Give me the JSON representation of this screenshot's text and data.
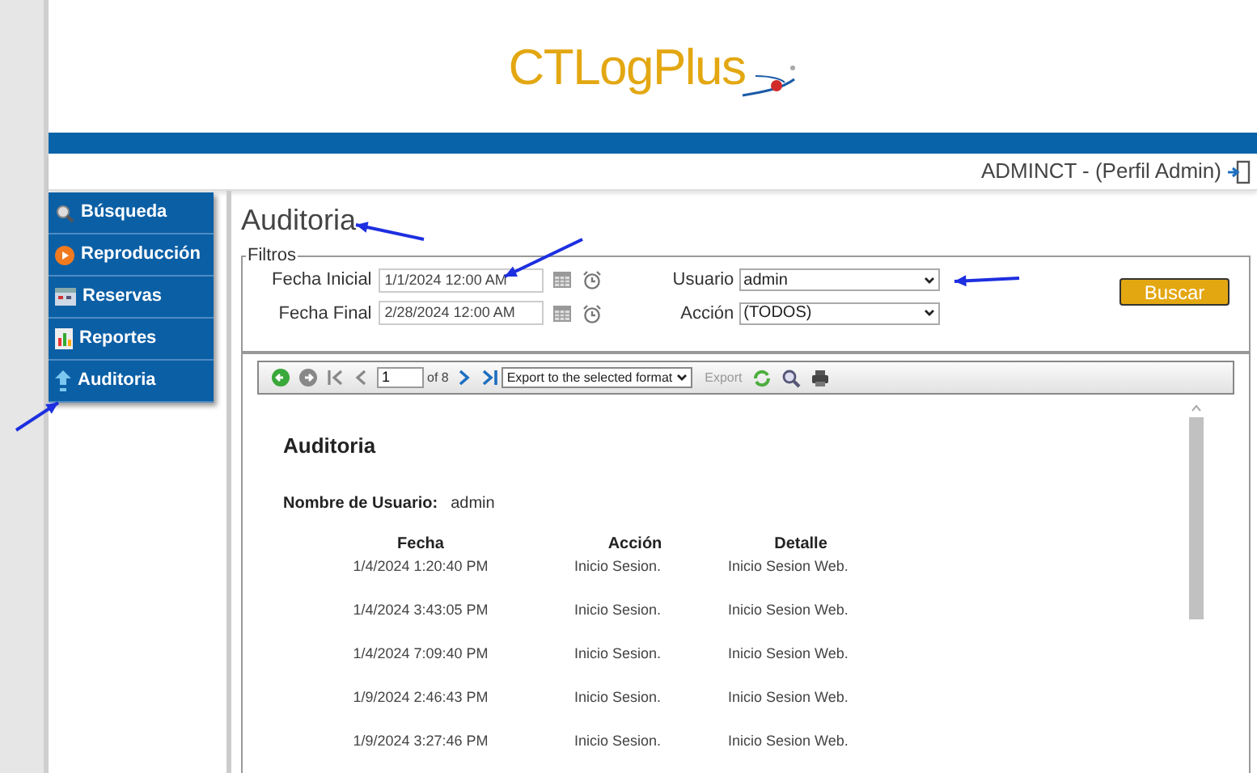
{
  "logo": {
    "text": "CTLogPlus"
  },
  "user_line": "ADMINCT - (Perfil Admin)",
  "menu": [
    {
      "label": "Búsqueda",
      "kind": "search"
    },
    {
      "label": "Reproducción",
      "kind": "play"
    },
    {
      "label": "Reservas",
      "kind": "calendar"
    },
    {
      "label": "Reportes",
      "kind": "report"
    },
    {
      "label": "Auditoria",
      "kind": "audit"
    }
  ],
  "page_title": "Auditoria",
  "filters": {
    "legend": "Filtros",
    "start_label": "Fecha Inicial",
    "start_value": "1/1/2024 12:00 AM",
    "end_label": "Fecha Final",
    "end_value": "2/28/2024 12:00 AM",
    "user_label": "Usuario",
    "user_value": "admin",
    "action_label": "Acción",
    "action_value": "(TODOS)",
    "search_button": "Buscar"
  },
  "toolbar": {
    "page": "1",
    "of": "of 8",
    "export_format": "Export to the selected format",
    "export_button": "Export"
  },
  "report": {
    "title": "Auditoria",
    "user_label": "Nombre de Usuario:",
    "user_value": "admin",
    "columns": [
      "Fecha",
      "Acción",
      "Detalle"
    ],
    "rows": [
      [
        "1/4/2024 1:20:40 PM",
        "Inicio Sesion.",
        "Inicio Sesion Web."
      ],
      [
        "1/4/2024 3:43:05 PM",
        "Inicio Sesion.",
        "Inicio Sesion Web."
      ],
      [
        "1/4/2024 7:09:40 PM",
        "Inicio Sesion.",
        "Inicio Sesion Web."
      ],
      [
        "1/9/2024 2:46:43 PM",
        "Inicio Sesion.",
        "Inicio Sesion Web."
      ],
      [
        "1/9/2024 3:27:46 PM",
        "Inicio Sesion.",
        "Inicio Sesion Web."
      ]
    ]
  }
}
